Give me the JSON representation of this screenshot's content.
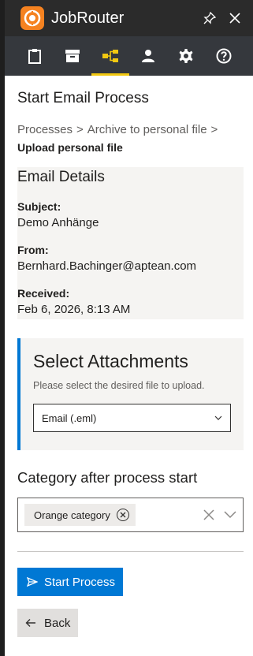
{
  "app": {
    "title": "JobRouter"
  },
  "nav": {
    "tabs": [
      "clipboard",
      "archive",
      "process-tree",
      "user",
      "settings",
      "help"
    ],
    "active": "process-tree"
  },
  "page": {
    "title": "Start Email Process"
  },
  "breadcrumb": {
    "items": [
      "Processes",
      "Archive to personal file"
    ],
    "separator": ">",
    "current": "Upload personal file"
  },
  "email_details": {
    "title": "Email Details",
    "subject_label": "Subject:",
    "subject_value": "Demo Anhänge",
    "from_label": "From:",
    "from_value": "Bernhard.Bachinger@aptean.com",
    "received_label": "Received:",
    "received_value": "Feb 6, 2026, 8:13 AM"
  },
  "attachments": {
    "title": "Select Attachments",
    "description": "Please select the desired file to upload.",
    "selected": "Email (.eml)"
  },
  "category": {
    "title": "Category after process start",
    "tag": "Orange category"
  },
  "actions": {
    "start_label": "Start Process",
    "back_label": "Back"
  },
  "colors": {
    "accent": "#0078d4",
    "nav_active": "#f2c811",
    "logo": "#f58220"
  }
}
